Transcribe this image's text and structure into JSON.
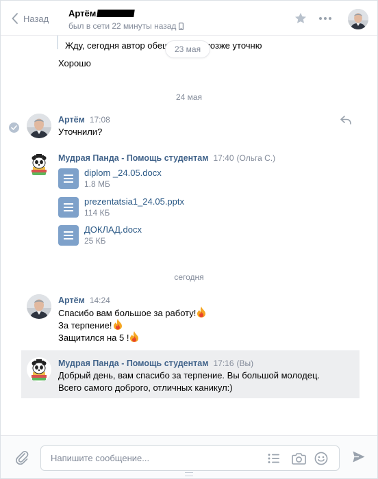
{
  "header": {
    "back_label": "Назад",
    "peer_name": "Артём",
    "peer_status": "был в сети 22 минуты назад"
  },
  "history": {
    "quote_text": "Жду, сегодня автор обещ… …ого позже уточню",
    "floating_date": "23 мая",
    "prev_message": "Хорошо"
  },
  "dates": {
    "may24": "24 мая",
    "today": "сегодня"
  },
  "messages": {
    "m1": {
      "author": "Артём",
      "time": "17:08",
      "lines": [
        "Уточнили?"
      ]
    },
    "m2": {
      "author": "Мудрая Панда - Помощь студентам",
      "time": "17:40",
      "sender": "(Ольга С.)",
      "files": [
        {
          "name": "diplom _24.05.docx",
          "size": "1.8 МБ"
        },
        {
          "name": "prezentatsia1_24.05.pptx",
          "size": "114 КБ"
        },
        {
          "name": "ДОКЛАД.docx",
          "size": "25 КБ"
        }
      ]
    },
    "m3": {
      "author": "Артём",
      "time": "14:24",
      "lines": [
        "Спасибо вам большое за работу!",
        "За терпение!",
        "Защитился на 5 !"
      ]
    },
    "m4": {
      "author": "Мудрая Панда - Помощь студентам",
      "time": "17:16",
      "sender": "(Вы)",
      "lines": [
        "Добрый день, вам спасибо за терпение. Вы большой молодец.",
        "Всего самого доброго, отличных каникул:)"
      ]
    }
  },
  "composer": {
    "placeholder": "Напишите сообщение..."
  },
  "colors": {
    "author": "#42648b",
    "link": "#2a5885",
    "muted": "#828a99",
    "file_icon": "#7ea1ca",
    "selected_bg": "#edeef0"
  },
  "icons": [
    "chevron-left-icon",
    "phone-icon",
    "star-icon",
    "more-icon",
    "check-icon",
    "reply-icon",
    "document-icon",
    "fire-emoji",
    "paperclip-icon",
    "list-icon",
    "camera-icon",
    "smile-icon",
    "send-icon"
  ]
}
